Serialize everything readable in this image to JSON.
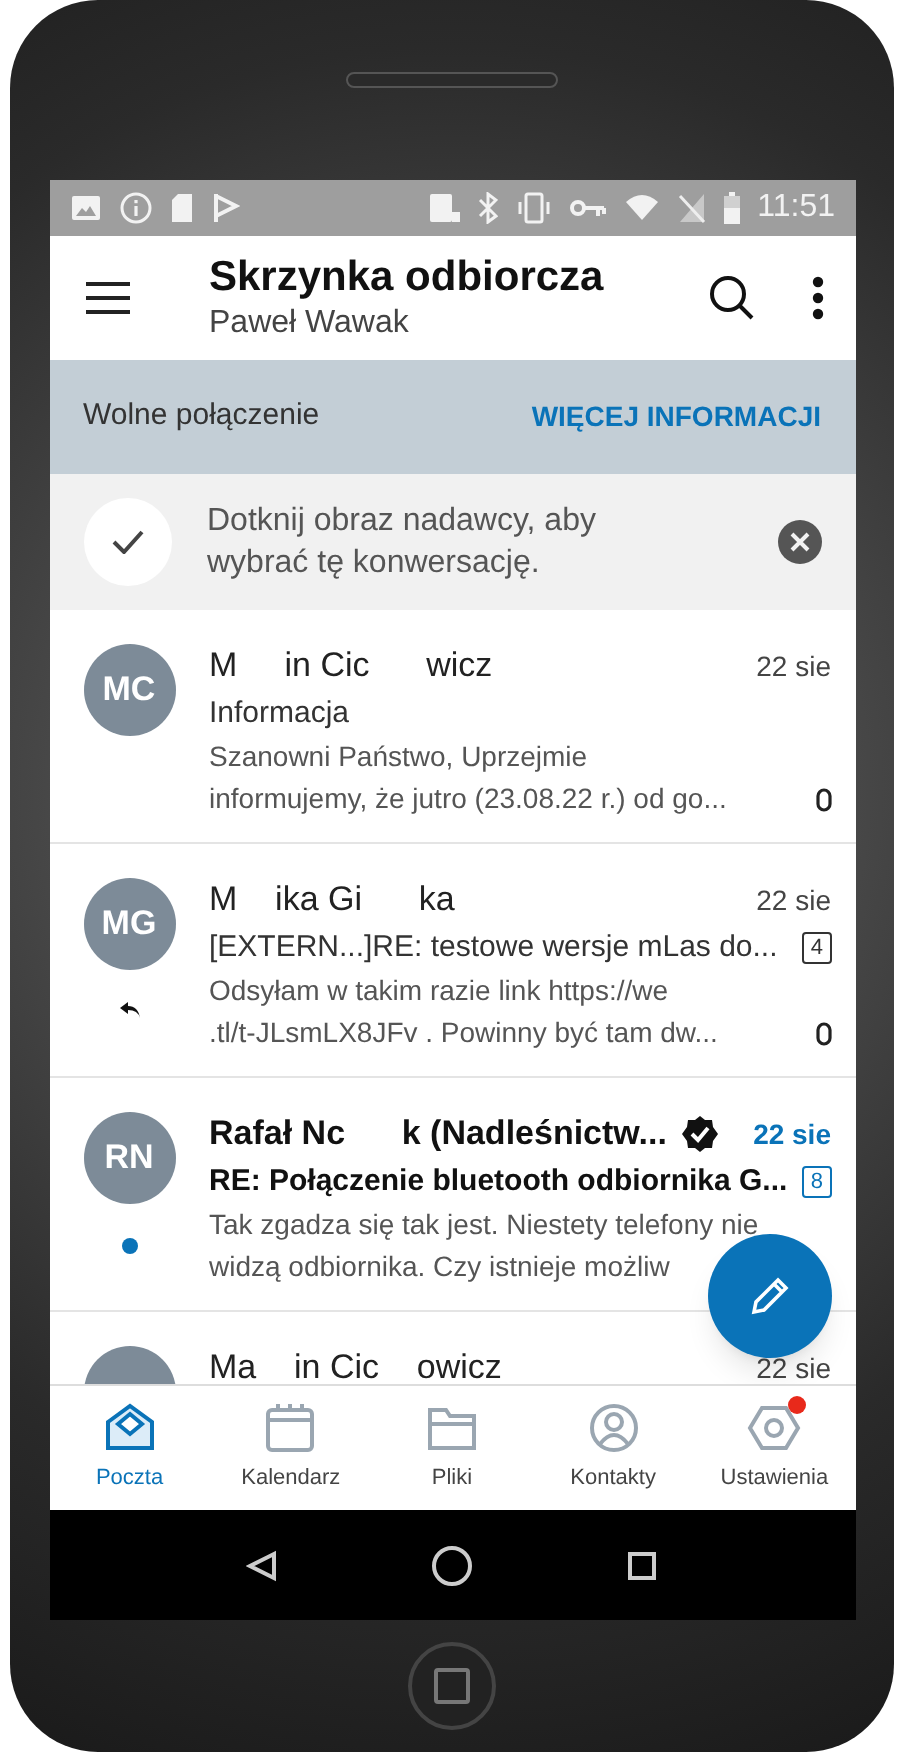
{
  "status_bar": {
    "time": "11:51"
  },
  "app_bar": {
    "title": "Skrzynka odbiorcza",
    "account": "Paweł Wawak"
  },
  "banner": {
    "text": "Wolne połączenie",
    "action": "WIĘCEJ INFORMACJI"
  },
  "tip": {
    "text": "Dotknij obraz nadawcy, aby wybrać tę konwersację."
  },
  "emails": [
    {
      "initials": "MC",
      "sender": "M     in Cic      wicz",
      "date": "22 sie",
      "subject": "Informacja",
      "preview_lines": [
        "Szanowni Państwo, Uprzejmie",
        "informujemy, że jutro (23.08.22 r.) od go..."
      ],
      "unread": false,
      "replied": false,
      "verified": false,
      "attachment": true
    },
    {
      "initials": "MG",
      "sender": "M    ika Gi      ka",
      "date": "22 sie",
      "subject": "[EXTERN...]RE: testowe wersje mLas do...",
      "thread_count": "4",
      "preview_lines": [
        "Odsyłam w takim razie link https://we",
        ".tl/t-JLsmLX8JFv . Powinny być tam dw..."
      ],
      "unread": false,
      "replied": true,
      "verified": false,
      "attachment": true
    },
    {
      "initials": "RN",
      "sender": "Rafał Nc      k (Nadleśnictw...",
      "date": "22 sie",
      "subject": "RE: Połączenie bluetooth odbiornika G...",
      "thread_count": "8",
      "preview_lines": [
        "Tak zgadza się tak jest. Niestety telefony nie",
        "widzą odbiornika. Czy istnieje możliw"
      ],
      "unread": true,
      "replied": false,
      "verified": true,
      "attachment": false
    },
    {
      "sender": "Ma    in Cic    owicz",
      "date": "22 sie",
      "unread": false,
      "replied": false,
      "verified": false,
      "attachment": false
    }
  ],
  "bottom_nav": [
    {
      "label": "Poczta",
      "kind": "mail",
      "selected": true,
      "badge": false
    },
    {
      "label": "Kalendarz",
      "kind": "calendar",
      "selected": false,
      "badge": false
    },
    {
      "label": "Pliki",
      "kind": "files",
      "selected": false,
      "badge": false
    },
    {
      "label": "Kontakty",
      "kind": "contacts",
      "selected": false,
      "badge": false
    },
    {
      "label": "Ustawienia",
      "kind": "settings",
      "selected": false,
      "badge": true
    }
  ]
}
